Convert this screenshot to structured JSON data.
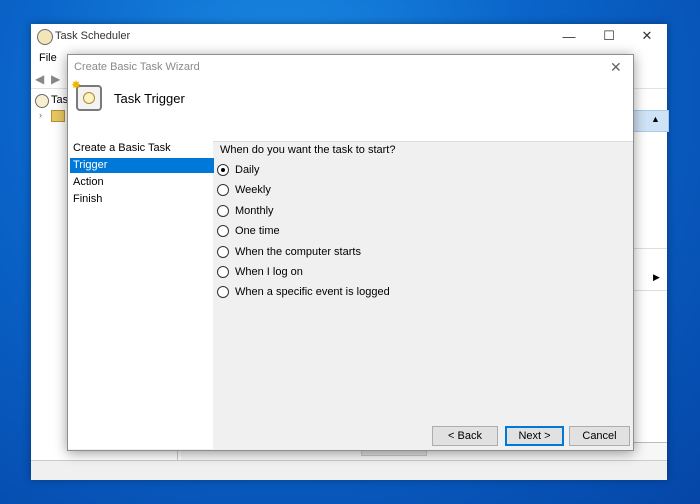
{
  "background_window": {
    "title": "Task Scheduler",
    "controls": {
      "minimize": "—",
      "maximize": "☐",
      "close": "✕"
    },
    "menu": {
      "file": "File"
    },
    "tree": {
      "root_label": "Task",
      "expander": "›"
    }
  },
  "wizard": {
    "title": "Create Basic Task Wizard",
    "close": "✕",
    "header_title": "Task Trigger",
    "steps": [
      "Create a Basic Task",
      "Trigger",
      "Action",
      "Finish"
    ],
    "selected_step": "Trigger",
    "question": "When do you want the task to start?",
    "options": [
      {
        "label": "Daily",
        "checked": true
      },
      {
        "label": "Weekly",
        "checked": false
      },
      {
        "label": "Monthly",
        "checked": false
      },
      {
        "label": "One time",
        "checked": false
      },
      {
        "label": "When the computer starts",
        "checked": false
      },
      {
        "label": "When I log on",
        "checked": false
      },
      {
        "label": "When a specific event is logged",
        "checked": false
      }
    ],
    "buttons": {
      "back": "< Back",
      "next": "Next >",
      "cancel": "Cancel"
    }
  },
  "colors": {
    "accent": "#0078d7",
    "desktop": "#0a64c9"
  }
}
